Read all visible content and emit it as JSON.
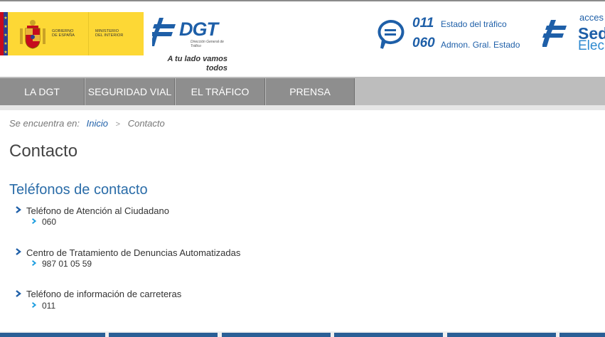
{
  "header": {
    "gov_logo": {
      "line_a": [
        "GOBIERNO",
        "DE ESPAÑA"
      ],
      "line_b": [
        "MINISTERIO",
        "DEL INTERIOR"
      ]
    },
    "dgt": {
      "word": "DGT",
      "sub": "Dirección General de Tráfico",
      "slogan_line1": "A tu lado vamos",
      "slogan_line2": "todos"
    },
    "phones": [
      {
        "number": "011",
        "label": "Estado del tráfico"
      },
      {
        "number": "060",
        "label": "Admon. Gral. Estado"
      }
    ],
    "sede": {
      "top": "acces",
      "mid": "Sed",
      "bot": "Elec"
    }
  },
  "nav": {
    "items": [
      "LA DGT",
      "SEGURIDAD VIAL",
      "EL TRÁFICO",
      "PRENSA"
    ]
  },
  "breadcrumb": {
    "prefix": "Se encuentra en:",
    "home": "Inicio",
    "separator": ">",
    "current": "Contacto"
  },
  "page_title": "Contacto",
  "section_title": "Teléfonos de contacto",
  "contacts": [
    {
      "label": "Teléfono de Atención al Ciudadano",
      "value": "060"
    },
    {
      "label": "Centro de Tratamiento de Denuncias Automatizadas",
      "value": "987 01 05 59"
    },
    {
      "label": "Teléfono de información de carreteras",
      "value": "011"
    }
  ],
  "colors": {
    "brand_blue": "#1e5fa8",
    "nav_grey": "#8e8e8e",
    "gov_yellow": "#fdd835"
  },
  "icons": {
    "phone": "chat-bubble-icon",
    "arrow": "chevron-right-icon"
  }
}
